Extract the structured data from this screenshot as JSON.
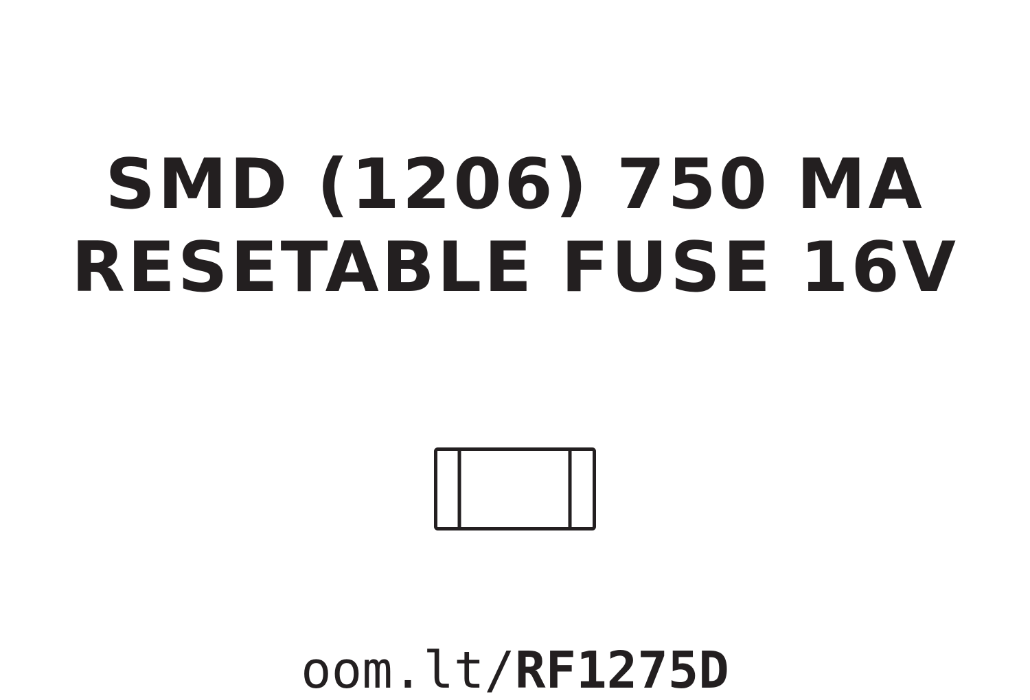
{
  "title": {
    "line1": "SMD (1206) 750 MA",
    "line2": "RESETABLE FUSE 16V"
  },
  "component_icon": "smd-1206-package-icon",
  "link": {
    "prefix": "oom.lt/",
    "code": "RF1275D"
  },
  "colors": {
    "text": "#231f20",
    "background": "#ffffff"
  }
}
